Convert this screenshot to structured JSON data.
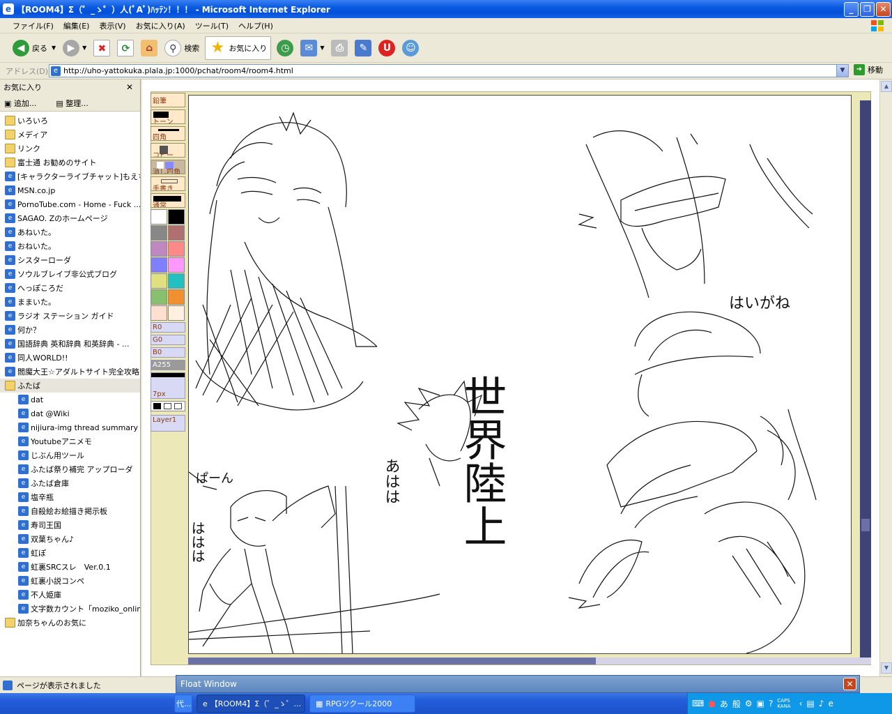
{
  "window": {
    "title": "【ROOM4】Σ（゜_ゝ゜）人(ﾟAﾟ)ﾊｯﾃﾝ！！！ - Microsoft Internet Explorer",
    "min": "_",
    "max": "❐",
    "close": "✕"
  },
  "menu": [
    "ファイル(F)",
    "編集(E)",
    "表示(V)",
    "お気に入り(A)",
    "ツール(T)",
    "ヘルプ(H)"
  ],
  "toolbar": {
    "back": "戻る",
    "search": "検索",
    "favorites": "お気に入り"
  },
  "address": {
    "label": "アドレス(D)",
    "url": "http://uho-yattokuka.plala.jp:1000/pchat/room4/room4.html",
    "go": "移動"
  },
  "favorites_pane": {
    "title": "お気に入り",
    "close": "✕",
    "add": "追加...",
    "organize": "整理...",
    "items": [
      {
        "label": "いろいろ",
        "type": "folder",
        "level": 0
      },
      {
        "label": "メディア",
        "type": "folder",
        "level": 0
      },
      {
        "label": "リンク",
        "type": "folder",
        "level": 0
      },
      {
        "label": "富士通 お勧めのサイト",
        "type": "folder",
        "level": 0
      },
      {
        "label": "[キャラクターライブチャット]もえちゃっ...",
        "type": "page",
        "level": 0
      },
      {
        "label": "MSN.co.jp",
        "type": "page",
        "level": 0
      },
      {
        "label": "PornoTube.com - Home - Fuck ...",
        "type": "page",
        "level": 0
      },
      {
        "label": "SAGAO. Zのホームページ",
        "type": "page",
        "level": 0
      },
      {
        "label": "あねいた。",
        "type": "page",
        "level": 0
      },
      {
        "label": "おねいた。",
        "type": "page",
        "level": 0
      },
      {
        "label": "シスターローダ",
        "type": "page",
        "level": 0
      },
      {
        "label": "ソウルブレイブ非公式ブログ",
        "type": "page",
        "level": 0
      },
      {
        "label": "へっぽころだ",
        "type": "page",
        "level": 0
      },
      {
        "label": "ままいた。",
        "type": "page",
        "level": 0
      },
      {
        "label": "ラジオ ステーション ガイド",
        "type": "page",
        "level": 0
      },
      {
        "label": "何か？",
        "type": "page",
        "level": 0
      },
      {
        "label": "国語辞典 英和辞典 和英辞典 - ...",
        "type": "page",
        "level": 0
      },
      {
        "label": "同人WORLD!!",
        "type": "page",
        "level": 0
      },
      {
        "label": "閻魔大王☆アダルトサイト完全攻略",
        "type": "page",
        "level": 0
      },
      {
        "label": "ふたば",
        "type": "folder",
        "level": 0,
        "open": true
      },
      {
        "label": "dat",
        "type": "page",
        "level": 1
      },
      {
        "label": "dat @Wiki",
        "type": "page",
        "level": 1
      },
      {
        "label": "nijiura-img thread summary",
        "type": "page",
        "level": 1
      },
      {
        "label": "Youtubeアニメモ",
        "type": "page",
        "level": 1
      },
      {
        "label": "じぶん用ツール",
        "type": "page",
        "level": 1
      },
      {
        "label": "ふたば祭り補完 アップローダ",
        "type": "page",
        "level": 1
      },
      {
        "label": "ふたば倉庫",
        "type": "page",
        "level": 1
      },
      {
        "label": "塩辛瓶",
        "type": "page",
        "level": 1
      },
      {
        "label": "自殺絵お絵描き掲示板",
        "type": "page",
        "level": 1
      },
      {
        "label": "寿司王国",
        "type": "page",
        "level": 1
      },
      {
        "label": "双葉ちゃん♪",
        "type": "page",
        "level": 1
      },
      {
        "label": "虹ぽ",
        "type": "page",
        "level": 1
      },
      {
        "label": "虹裏SRCスレ　Ver.0.1",
        "type": "page",
        "level": 1
      },
      {
        "label": "虹裏小説コンペ",
        "type": "page",
        "level": 1
      },
      {
        "label": "不人姫庫",
        "type": "page",
        "level": 1
      },
      {
        "label": "文字数カウント「moziko_online...",
        "type": "page",
        "level": 1
      },
      {
        "label": "加奈ちゃんのお気に",
        "type": "folder",
        "level": 0
      }
    ]
  },
  "paint_tools": {
    "tools": [
      "鉛筆",
      "トーン",
      "四角",
      "コピー",
      "消し四角",
      "手書き",
      "通常"
    ],
    "rgb": [
      "R0",
      "G0",
      "B0",
      "A255"
    ],
    "size": "7px",
    "layer": "Layer1",
    "palette": [
      "#ffffff",
      "#000000",
      "#888888",
      "#b07070",
      "#c088c0",
      "#ff8888",
      "#7f7fff",
      "#ff99ff",
      "#e0e080",
      "#22c0c0",
      "#88c070",
      "#f09030",
      "#ffe0d0",
      "#fff0e0"
    ]
  },
  "canvas_text": {
    "t1": "世界陸上",
    "t2": "はいがね",
    "t3": "あはは",
    "t4": "ははは",
    "t5": "ぱーん"
  },
  "status": {
    "text": "ページが表示されました"
  },
  "float_window": {
    "title": "Float Window",
    "close": "✕"
  },
  "taskbar": {
    "tasks": [
      "代...",
      "【ROOM4】Σ（゜_ゝ゜...",
      "RPGツクール2000"
    ],
    "tray": [
      "あ",
      "般",
      "CAPS",
      "KANA"
    ]
  }
}
